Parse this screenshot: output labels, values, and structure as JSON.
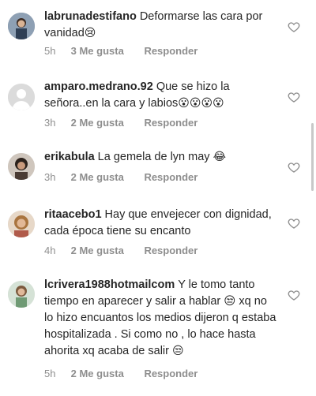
{
  "comments": [
    {
      "username": "labrunadestifano",
      "text": "Deformarse las cara por vanidad",
      "emoji": "😢",
      "time": "5h",
      "likes": "3 Me gusta",
      "reply": "Responder",
      "avatar_color": "#7a8c9e"
    },
    {
      "username": "amparo.medrano.92",
      "text": "Que se hizo la señora..en la cara y labios",
      "emoji": "😮😮😮😮",
      "time": "3h",
      "likes": "2 Me gusta",
      "reply": "Responder",
      "avatar_color": "#dbdbdb"
    },
    {
      "username": "erikabula",
      "text": "La gemela de lyn may",
      "emoji": "😂",
      "time": "3h",
      "likes": "2 Me gusta",
      "reply": "Responder",
      "avatar_color": "#5a4a3e"
    },
    {
      "username": "ritaacebo1",
      "text": "Hay que envejecer con dignidad, cada época tiene su encanto",
      "emoji": "",
      "time": "4h",
      "likes": "2 Me gusta",
      "reply": "Responder",
      "avatar_color": "#c49a7a"
    },
    {
      "username": "lcrivera1988hotmailcom",
      "text": "Y le tomo tanto tiempo en aparecer y salir a hablar 😒 xq no lo hizo encuantos los medios dijeron q estaba hospitalizada . Si como no , lo hace hasta ahorita xq acaba de salir",
      "emoji": "😒",
      "time": "5h",
      "likes": "2 Me gusta",
      "reply": "Responder",
      "avatar_color": "#9fb5a0"
    }
  ],
  "icons": {
    "like": "heart-outline-icon",
    "default_avatar": "default-avatar-icon"
  },
  "colors": {
    "text": "#262626",
    "secondary": "#8e8e8e",
    "background": "#ffffff"
  }
}
